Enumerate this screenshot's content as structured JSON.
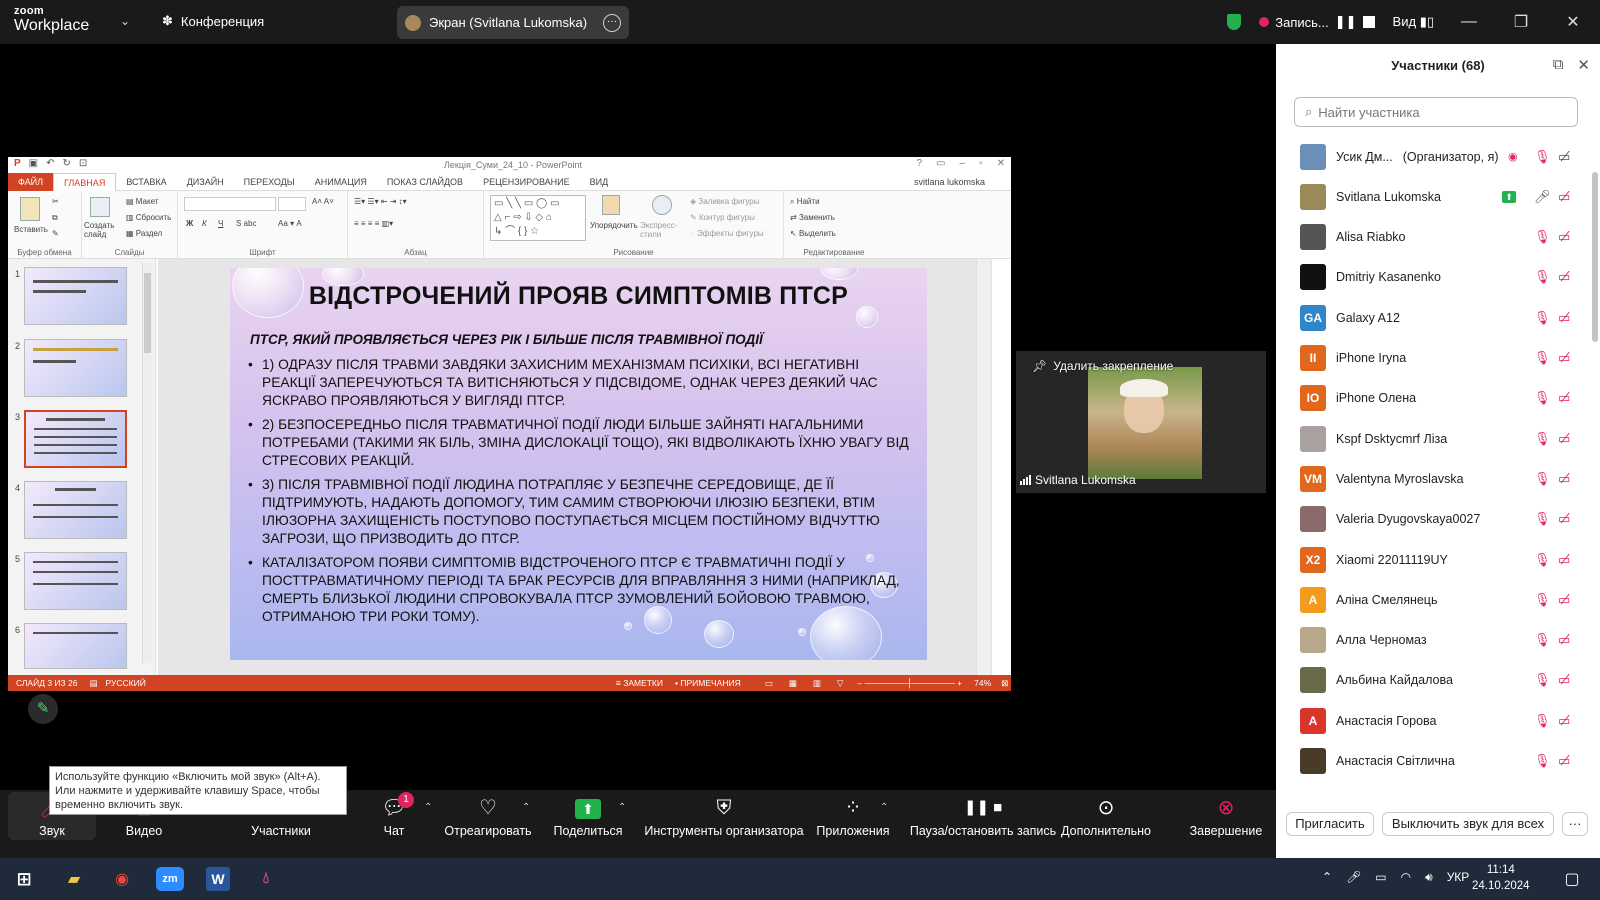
{
  "topbar": {
    "logo_line1": "zoom",
    "logo_line2": "Workplace",
    "conference_label": "Конференция",
    "screen_share_label": "Экран (Svitlana Lukomska)",
    "record_label": "Запись...",
    "view_label": "Вид"
  },
  "ppt": {
    "window_title": "Лекція_Суми_24_10 - PowerPoint",
    "user": "svitlana lukomska",
    "tabs": [
      "ФАЙЛ",
      "ГЛАВНАЯ",
      "ВСТАВКА",
      "ДИЗАЙН",
      "ПЕРЕХОДЫ",
      "АНИМАЦИЯ",
      "ПОКАЗ СЛАЙДОВ",
      "РЕЦЕНЗИРОВАНИЕ",
      "ВИД"
    ],
    "ribbon": {
      "paste": "Вставить",
      "new_slide": "Создать слайд",
      "layout": "Макет",
      "reset": "Сбросить",
      "section": "Раздел",
      "arrange": "Упорядочить",
      "quick_styles": "Экспресс-стили",
      "fill": "Заливка фигуры",
      "outline": "Контур фигуры",
      "effects": "Эффекты фигуры",
      "find": "Найти",
      "replace": "Заменить",
      "select": "Выделить",
      "groups": [
        "Буфер обмена",
        "Слайды",
        "Шрифт",
        "Абзац",
        "Рисование",
        "Редактирование"
      ]
    },
    "thumb_numbers": [
      "1",
      "2",
      "3",
      "4",
      "5",
      "6"
    ],
    "status": {
      "slide_count": "СЛАЙД 3 ИЗ 26",
      "language": "РУССКИЙ",
      "notes": "ЗАМЕТКИ",
      "comments": "ПРИМЕЧАНИЯ",
      "zoom": "74%"
    }
  },
  "slide": {
    "title": "ВІДСТРОЧЕНИЙ ПРОЯВ СИМПТОМІВ ПТСР",
    "subtitle": "ПТСР, ЯКИЙ ПРОЯВЛЯЄТЬСЯ ЧЕРЕЗ РІК І БІЛЬШЕ ПІСЛЯ ТРАВМІВНОЇ ПОДІЇ",
    "bullets": [
      "1) ОДРАЗУ ПІСЛЯ ТРАВМИ ЗАВДЯКИ ЗАХИСНИМ МЕХАНІЗМАМ ПСИХІКИ, ВСІ НЕГАТИВНІ РЕАКЦІЇ ЗАПЕРЕЧУЮТЬСЯ ТА ВИТІСНЯЮТЬСЯ У ПІДСВІДОМЕ, ОДНАК ЧЕРЕЗ ДЕЯКИЙ ЧАС ЯСКРАВО ПРОЯВЛЯЮТЬСЯ У ВИГЛЯДІ ПТСР.",
      "2) БЕЗПОСЕРЕДНЬО ПІСЛЯ ТРАВМАТИЧНОЇ ПОДІЇ ЛЮДИ БІЛЬШЕ ЗАЙНЯТІ НАГАЛЬНИМИ ПОТРЕБАМИ (ТАКИМИ ЯК БІЛЬ, ЗМІНА ДИСЛОКАЦІЇ ТОЩО), ЯКІ ВІДВОЛІКАЮТЬ ЇХНЮ УВАГУ ВІД СТРЕСОВИХ РЕАКЦІЙ.",
      "3) ПІСЛЯ ТРАВМІВНОЇ ПОДІЇ ЛЮДИНА ПОТРАПЛЯЄ У БЕЗПЕЧНЕ СЕРЕДОВИЩЕ, ДЕ ЇЇ ПІДТРИМУЮТЬ, НАДАЮТЬ ДОПОМОГУ, ТИМ САМИМ СТВОРЮЮЧИ ІЛЮЗІЮ БЕЗПЕКИ, ВТІМ ІЛЮЗОРНА ЗАХИЩЕНІСТЬ ПОСТУПОВО ПОСТУПАЄТЬСЯ МІСЦЕМ ПОСТІЙНОМУ ВІДЧУТТЮ ЗАГРОЗИ, ЩО ПРИЗВОДИТЬ ДО ПТСР.",
      "КАТАЛІЗАТОРОМ ПОЯВИ СИМПТОМІВ ВІДСТРОЧЕНОГО ПТСР Є ТРАВМАТИЧНІ ПОДІЇ У ПОСТТРАВМАТИЧНОМУ ПЕРІОДІ ТА БРАК РЕСУРСІВ ДЛЯ ВПРАВЛЯННЯ З НИМИ (НАПРИКЛАД, СМЕРТЬ БЛИЗЬКОЇ ЛЮДИНИ СПРОВОКУВАЛА ПТСР ЗУМОВЛЕНИЙ БОЙОВОЮ ТРАВМОЮ, ОТРИМАНОЮ ТРИ РОКИ ТОМУ)."
    ]
  },
  "video": {
    "unpin_label": "Удалить закрепление",
    "name": "Svitlana Lukomska"
  },
  "participants": {
    "title": "Участники (68)",
    "search_placeholder": "Найти участника",
    "list": [
      {
        "name": "Усик Дм...",
        "role": "(Организатор, я)",
        "initials": "",
        "color": "#6b8fb8"
      },
      {
        "name": "Svitlana Lukomska",
        "role": "",
        "initials": "",
        "color": "#9a8a5a"
      },
      {
        "name": "Alisa Riabko",
        "role": "",
        "initials": "",
        "color": "#555555"
      },
      {
        "name": "Dmitriy Kasanenko",
        "role": "",
        "initials": "",
        "color": "#111111"
      },
      {
        "name": "Galaxy A12",
        "role": "",
        "initials": "GA",
        "color": "#2f86c9"
      },
      {
        "name": "iPhone Iryna",
        "role": "",
        "initials": "II",
        "color": "#e0671b"
      },
      {
        "name": "iPhone Олена",
        "role": "",
        "initials": "IO",
        "color": "#e0671b"
      },
      {
        "name": "Kspf Dsktycmrf Ліза",
        "role": "",
        "initials": "",
        "color": "#a9a0a0"
      },
      {
        "name": "Valentyna Myroslavska",
        "role": "",
        "initials": "VM",
        "color": "#e0671b"
      },
      {
        "name": "Valeria Dyugovskaya0027",
        "role": "",
        "initials": "",
        "color": "#8a6a6a"
      },
      {
        "name": "Xiaomi 22011119UY",
        "role": "",
        "initials": "X2",
        "color": "#e0671b"
      },
      {
        "name": "Аліна Смелянець",
        "role": "",
        "initials": "А",
        "color": "#f29b1c"
      },
      {
        "name": "Алла Черномаз",
        "role": "",
        "initials": "",
        "color": "#b8a88a"
      },
      {
        "name": "Альбина Кайдалова",
        "role": "",
        "initials": "",
        "color": "#6a6a4a"
      },
      {
        "name": "Анастасія Горова",
        "role": "",
        "initials": "А",
        "color": "#d9352b"
      },
      {
        "name": "Анастасія Світлична",
        "role": "",
        "initials": "",
        "color": "#4a3a2a"
      }
    ],
    "invite_label": "Пригласить",
    "mute_all_label": "Выключить звук для всех"
  },
  "toolbar": {
    "audio": "Звук",
    "video": "Видео",
    "participants": "Участники",
    "chat": "Чат",
    "chat_badge": "1",
    "react": "Отреагировать",
    "share": "Поделиться",
    "host_tools": "Инструменты организатора",
    "apps": "Приложения",
    "pause_record": "Пауза/остановить запись",
    "more": "Дополнительно",
    "end": "Завершение"
  },
  "tooltip": "Используйте функцию «Включить мой звук» (Alt+A). Или нажмите и удерживайте клавишу Space, чтобы временно включить звук.",
  "taskbar": {
    "lang": "УКР",
    "time": "11:14",
    "date": "24.10.2024"
  }
}
